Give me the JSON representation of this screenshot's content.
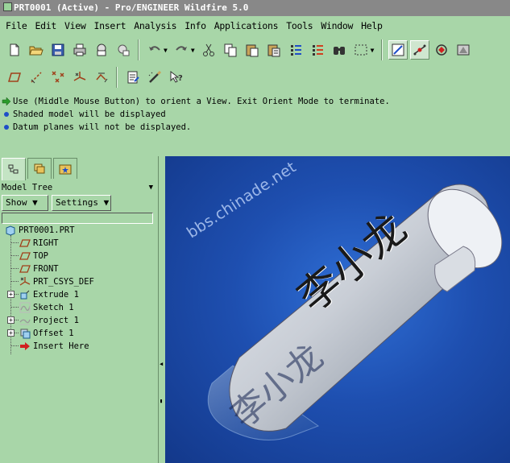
{
  "window": {
    "title": "PRT0001 (Active) - Pro/ENGINEER Wildfire 5.0"
  },
  "menu": [
    "File",
    "Edit",
    "View",
    "Insert",
    "Analysis",
    "Info",
    "Applications",
    "Tools",
    "Window",
    "Help"
  ],
  "toolbar1": [
    "new-icon",
    "open-icon",
    "save-icon",
    "print-icon",
    "send-mail-icon",
    "mail-attach-icon",
    "undo-icon",
    "redo-icon",
    "cut-icon",
    "copy-icon",
    "paste-icon",
    "paste-special-icon",
    "regenerate-icon",
    "regenerate-manager-icon",
    "find-icon",
    "select-box-icon",
    "datum-display-icon",
    "spin-center-icon",
    "orient-mode-icon",
    "saved-views-icon"
  ],
  "toolbar2": [
    "datum-plane-icon",
    "datum-axis-icon",
    "datum-point-icon",
    "datum-csys-icon",
    "annotation-icon",
    "model-info-icon",
    "repaint-icon",
    "context-help-icon"
  ],
  "messages": [
    {
      "icon": "arrow-icon",
      "text": "Use (Middle Mouse Button) to orient a  View.   Exit Orient Mode to terminate."
    },
    {
      "icon": "info-dot-icon",
      "text": "Shaded model will be displayed"
    },
    {
      "icon": "info-dot-icon",
      "text": "Datum planes will not be displayed."
    }
  ],
  "panel": {
    "tabs": [
      "model-tree-tab",
      "layer-tab",
      "favorites-tab"
    ],
    "title": "Model Tree",
    "show_label": "Show",
    "settings_label": "Settings",
    "tree": [
      {
        "label": "PRT0001.PRT",
        "icon": "part-icon"
      },
      {
        "label": "RIGHT",
        "icon": "datum-plane-icon"
      },
      {
        "label": "TOP",
        "icon": "datum-plane-icon"
      },
      {
        "label": "FRONT",
        "icon": "datum-plane-icon"
      },
      {
        "label": "PRT_CSYS_DEF",
        "icon": "csys-icon"
      },
      {
        "label": "Extrude 1",
        "icon": "extrude-icon"
      },
      {
        "label": "Sketch 1",
        "icon": "sketch-icon"
      },
      {
        "label": "Project 1",
        "icon": "project-icon"
      },
      {
        "label": "Offset 1",
        "icon": "offset-icon"
      },
      {
        "label": "Insert Here",
        "icon": "insert-here-arrow-icon"
      }
    ]
  },
  "viewport": {
    "watermark": "bbs.chinade.net",
    "embossed_text": "李小龙",
    "engraved_text": "李小龙",
    "background_color": "#1e4fb0"
  }
}
